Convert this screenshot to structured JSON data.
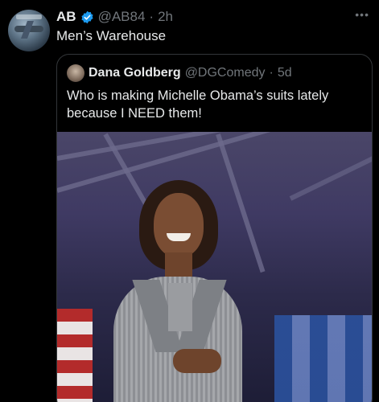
{
  "author": {
    "name": "AB",
    "handle": "@AB84",
    "time": "2h",
    "verified": true,
    "avatar_icon": "avatar-image"
  },
  "tweet_text": "Men’s Warehouse",
  "more_icon": "more-dots-icon",
  "quote": {
    "name": "Dana Goldberg",
    "handle": "@DGComedy",
    "time": "5d",
    "text": "Who is making Michelle Obama’s suits lately because I NEED them!",
    "avatar_icon": "avatar-image"
  },
  "colors": {
    "background": "#000000",
    "text": "#e7e9ea",
    "muted": "#71767b",
    "verified": "#1d9bf0",
    "border": "#333639"
  }
}
